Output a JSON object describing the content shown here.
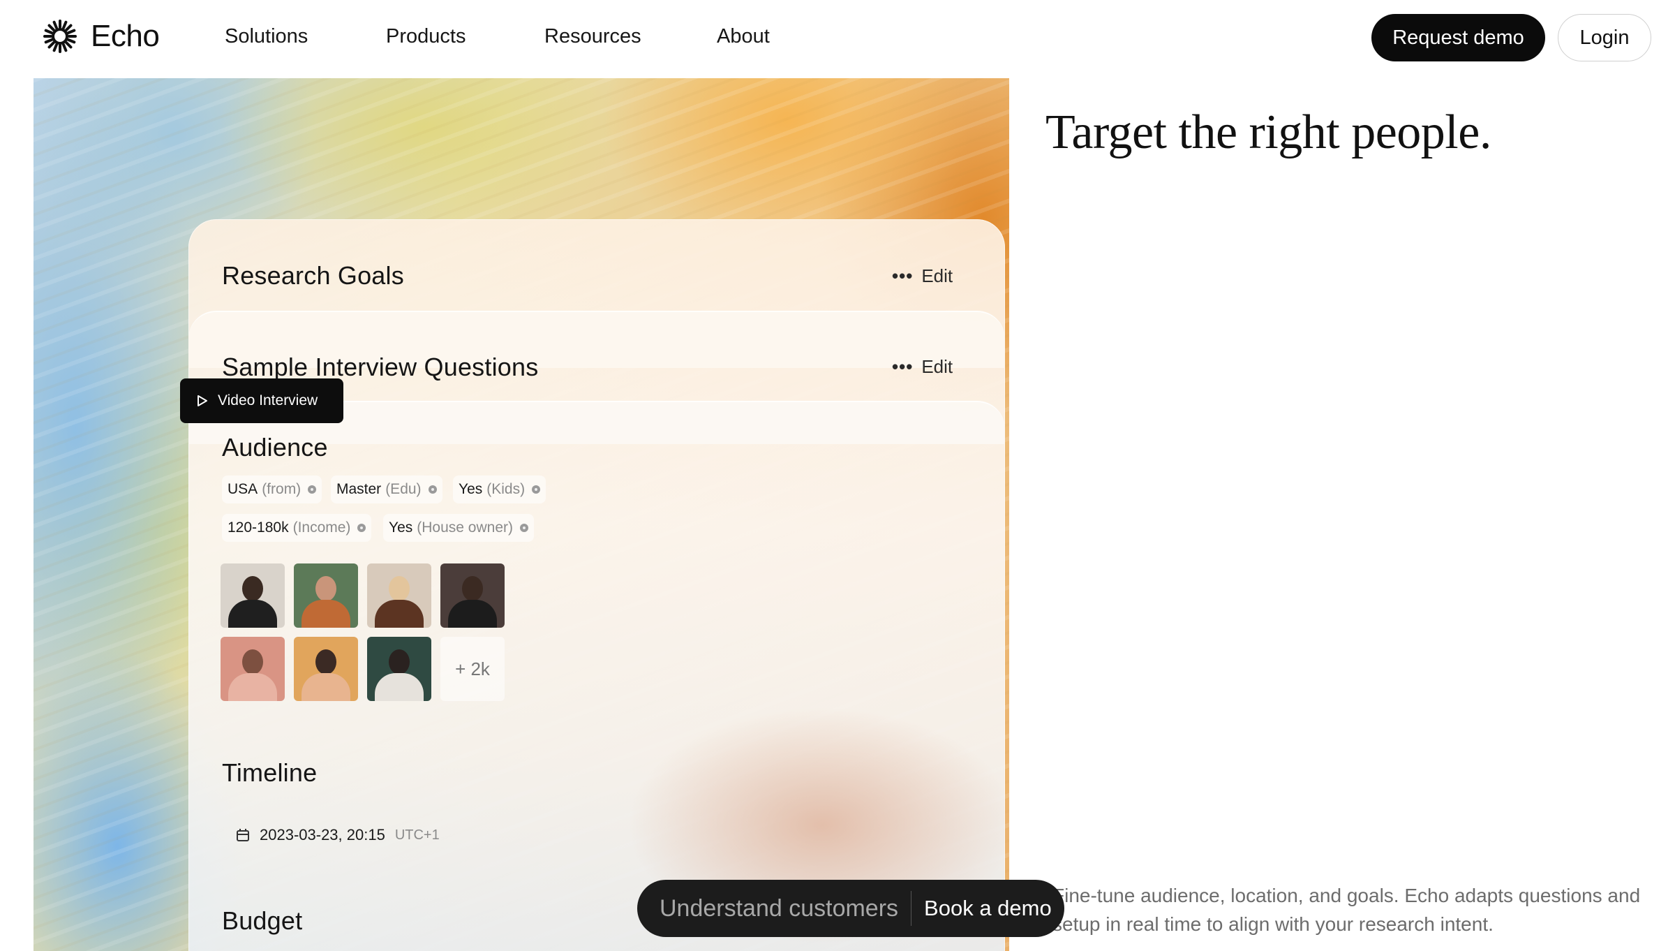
{
  "nav": {
    "logo_text": "Echo",
    "links": [
      "Solutions",
      "Products",
      "Resources",
      "About"
    ],
    "request_demo": "Request demo",
    "login": "Login"
  },
  "card": {
    "research_goals": "Research Goals",
    "interview_questions": "Sample Interview Questions",
    "edit_label": "Edit",
    "video_label": "Video Interview",
    "audience": {
      "title": "Audience",
      "tags": [
        {
          "value": "USA",
          "sub": "(from)"
        },
        {
          "value": "Master",
          "sub": "(Edu)"
        },
        {
          "value": "Yes",
          "sub": "(Kids)"
        },
        {
          "value": "120-180k",
          "sub": "(Income)"
        },
        {
          "value": "Yes",
          "sub": "(House owner)"
        }
      ],
      "more": "+ 2k"
    },
    "timeline": {
      "title": "Timeline",
      "date": "2023-03-23, 20:15",
      "tz": "UTC+1"
    },
    "budget": "Budget"
  },
  "headline": "Target the right people.",
  "description": "Fine-tune audience, location, and goals. Echo adapts questions and setup in real time to align with your research intent.",
  "cta": {
    "left": "Understand customers",
    "right": "Book a demo"
  },
  "colors": {
    "accent": "#0b0b0b",
    "muted": "#6c6c6c"
  }
}
